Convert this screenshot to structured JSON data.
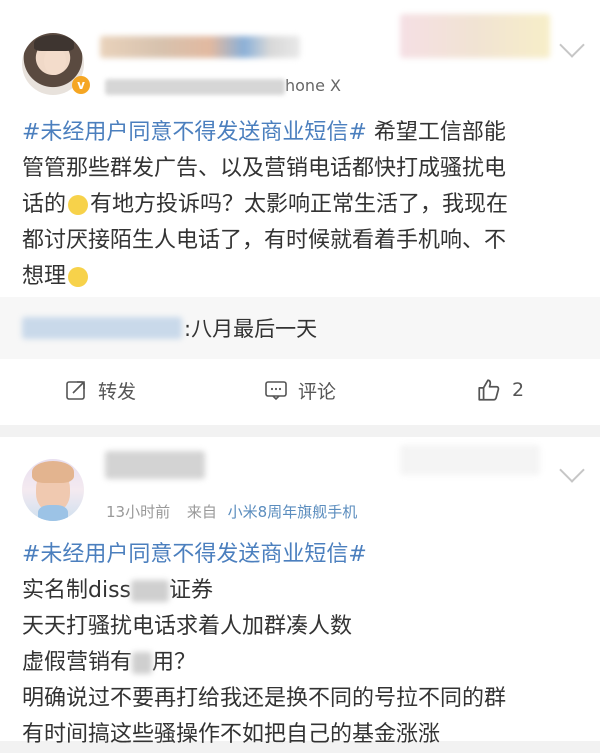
{
  "post1": {
    "meta_suffix": "hone X",
    "verified_mark": "v",
    "hashtag": "#未经用户同意不得发送商业短信#",
    "lines": [
      " 希望工信部能",
      "管管那些群发广告、以及营销电话都快打成骚扰电",
      "有地方投诉吗？太影响正常生活了，我现在",
      "都讨厌接陌生人电话了，有时候就看着手机响、不",
      "想理"
    ],
    "line3_prefix": "话的",
    "repost_text": ":八月最后一天",
    "actions": {
      "repost": "转发",
      "comment": "评论",
      "like_count": "2"
    }
  },
  "post2": {
    "time": "13小时前",
    "from_label": "来自",
    "source": "小米8周年旗舰手机",
    "hashtag": "#未经用户同意不得发送商业短信#",
    "line2a": "实名制diss",
    "line2b": "证券",
    "line3": "天天打骚扰电话求着人加群凑人数",
    "line4a": "虚假营销有",
    "line4b": "用？",
    "line5": "明确说过不要再打给我还是换不同的号拉不同的群",
    "line6": "有时间搞这些骚操作不如把自己的基金涨涨"
  },
  "colors": {
    "link": "#4b7fbe",
    "source": "#5b8dbe",
    "badge": "#f5a623",
    "background": "#f2f2f2"
  },
  "icons": [
    "chevron-down-icon",
    "repost-icon",
    "comment-icon",
    "like-icon",
    "emoji-icon"
  ]
}
